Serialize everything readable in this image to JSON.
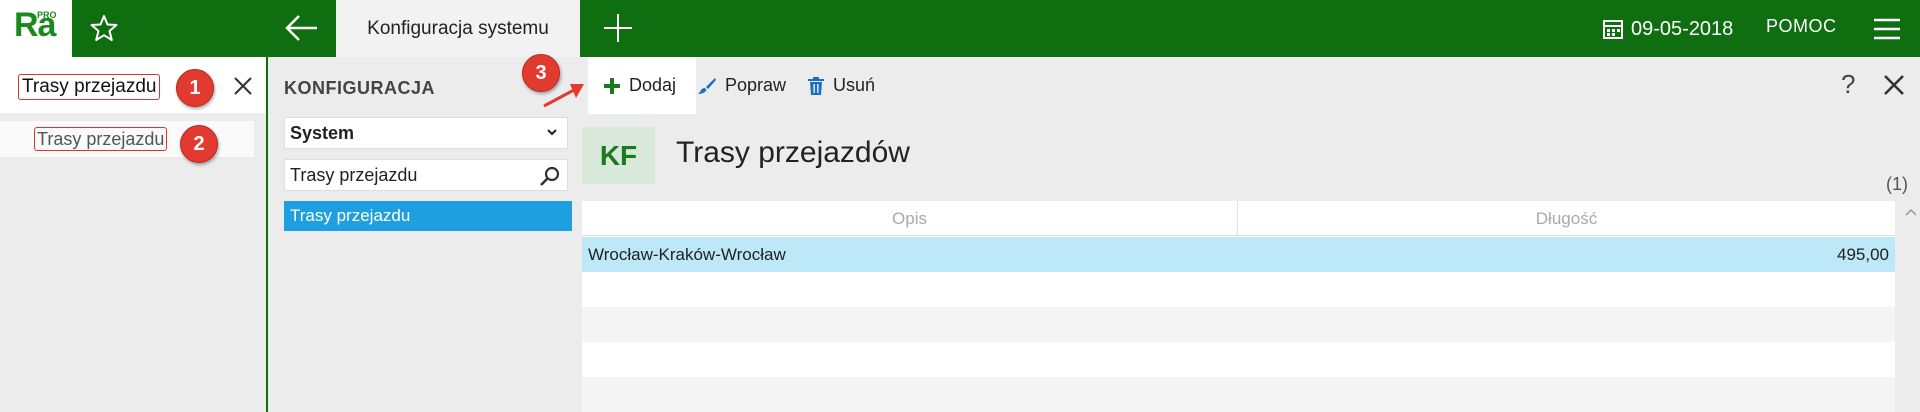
{
  "app": {
    "logo_text": "Ra",
    "logo_sup": "PRO"
  },
  "topbar": {
    "tab_title": "Konfiguracja systemu",
    "date": "09-05-2018",
    "help_label": "POMOC"
  },
  "left": {
    "search_value": "Trasy przejazdu",
    "result": "Trasy przejazdu"
  },
  "config": {
    "title": "KONFIGURACJA",
    "select_value": "System",
    "search_value": "Trasy przejazdu",
    "items": [
      "Trasy przejazdu"
    ]
  },
  "toolbar": {
    "add_label": "Dodaj",
    "edit_label": "Popraw",
    "delete_label": "Usuń",
    "help_label": "?"
  },
  "content": {
    "badge": "KF",
    "title": "Trasy przejazdów",
    "count": "(1)",
    "columns": [
      "Opis",
      "Długość"
    ],
    "rows": [
      {
        "opis": "Wrocław-Kraków-Wrocław",
        "dlugosc": "495,00"
      }
    ]
  },
  "annotations": [
    "1",
    "2",
    "3"
  ],
  "colors": {
    "brand_green": "#0f6e10",
    "selection_blue": "#1e9fe0",
    "row_selected": "#bde8f7",
    "annotation_red": "#e23a2e"
  }
}
